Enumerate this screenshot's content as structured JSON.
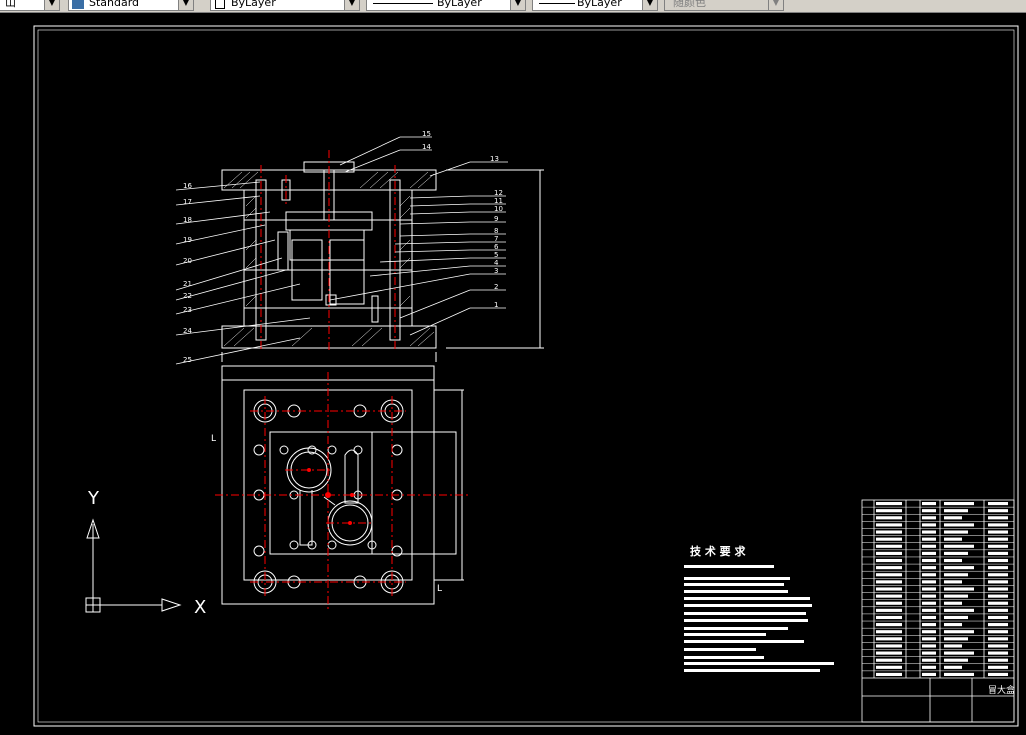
{
  "toolbar": {
    "left_combo": "山",
    "style_combo": "Standard",
    "layer_combo": "ByLayer",
    "linetype_combo": "ByLayer",
    "lineweight_combo": "ByLayer",
    "color_combo": "随颜色"
  },
  "drawing": {
    "balloons": [
      "15",
      "14",
      "13",
      "16",
      "17",
      "18",
      "19",
      "20",
      "21",
      "22",
      "23",
      "24",
      "25",
      "12",
      "11",
      "10",
      "9",
      "8",
      "7",
      "6",
      "5",
      "4",
      "3",
      "2",
      "1"
    ],
    "letter_L_top": "L",
    "letter_L_bottom": "L",
    "tech_title": "技 术 要 求",
    "ucs_x": "X",
    "ucs_y": "Y"
  },
  "title_block": {
    "drawing_name": "冒大盒"
  },
  "colors": {
    "background": "#000000",
    "line": "#ffffff",
    "center": "#ff0000",
    "toolbar": "#d4d0c8"
  }
}
